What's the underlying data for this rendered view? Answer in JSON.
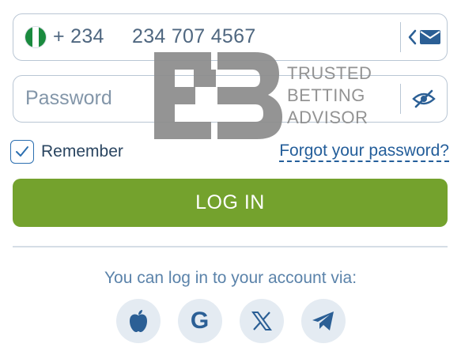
{
  "phone": {
    "country_code": "+ 234",
    "number": "234 707 4567",
    "flag_colors": [
      "#1a8a3e",
      "#ffffff",
      "#1a8a3e"
    ]
  },
  "password": {
    "placeholder": "Password"
  },
  "remember": {
    "label": "Remember",
    "checked": true
  },
  "forgot_link": "Forgot your password?",
  "login_button": "LOG IN",
  "social": {
    "caption": "You can log in to your account via:",
    "providers": [
      "apple-icon",
      "google-icon",
      "x-icon",
      "telegram-icon"
    ],
    "google_glyph": "G"
  },
  "watermark": {
    "line1": "TRUSTED",
    "line2": "BETTING",
    "line3": "ADVISOR"
  },
  "colors": {
    "accent": "#74a22d",
    "link": "#245e9a",
    "border": "#b9c6d4"
  }
}
